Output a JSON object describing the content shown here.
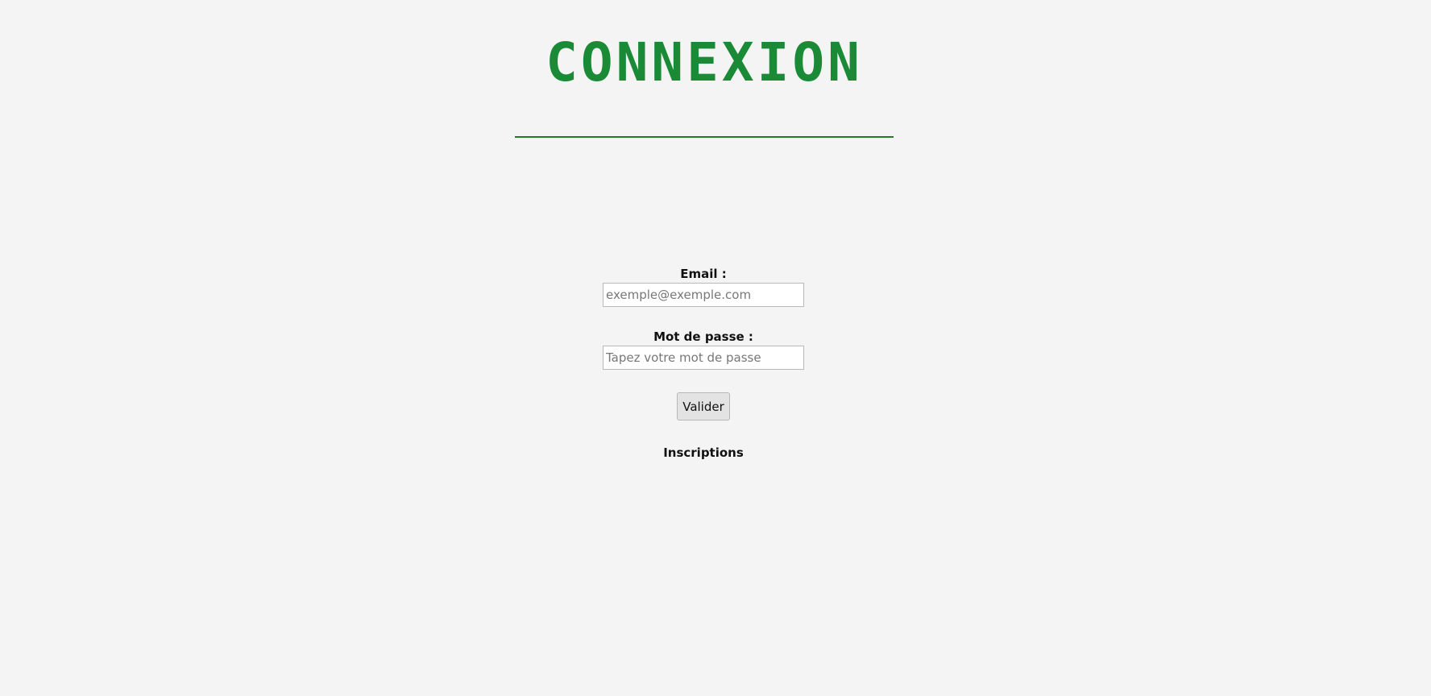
{
  "header": {
    "title": "CONNEXION"
  },
  "form": {
    "email": {
      "label": "Email :",
      "placeholder": "exemple@exemple.com",
      "value": ""
    },
    "password": {
      "label": "Mot de passe :",
      "placeholder": "Tapez votre mot de passe",
      "value": ""
    },
    "submit_label": "Valider",
    "signup_link": "Inscriptions"
  },
  "colors": {
    "accent": "#1b8a36",
    "divider": "#1e7d1e",
    "background": "#f4f4f4"
  }
}
